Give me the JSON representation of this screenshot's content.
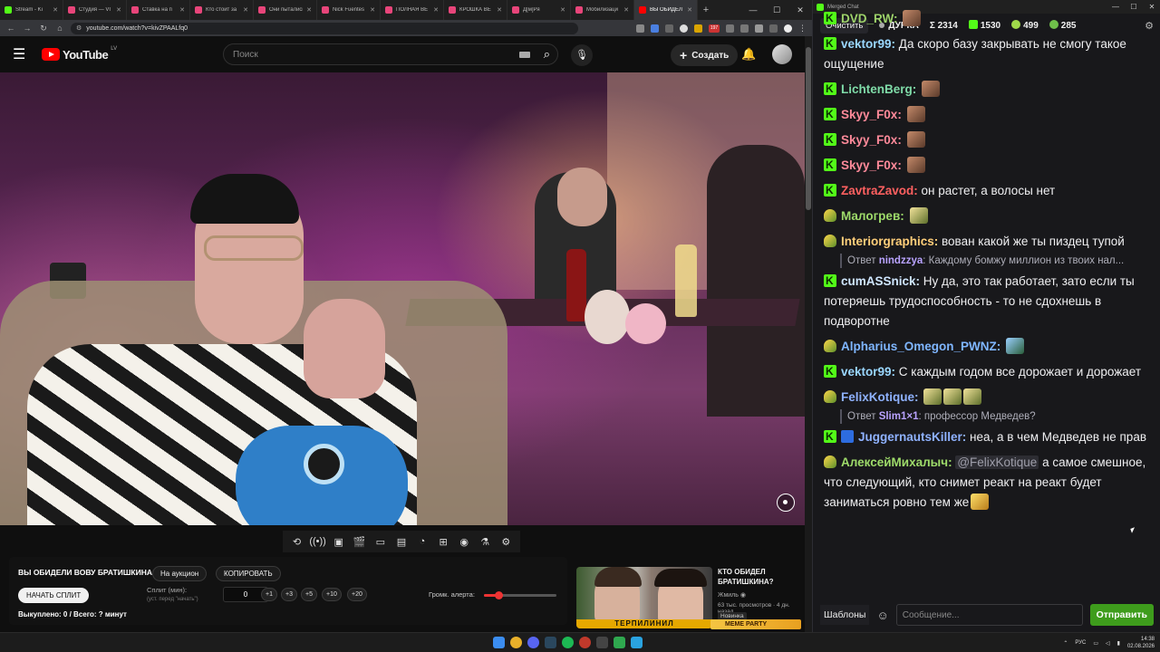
{
  "browser": {
    "tabs": [
      {
        "title": "Stream - Ki",
        "color": "#53fc18"
      },
      {
        "title": "Студия — VI",
        "color": "#e8457a"
      },
      {
        "title": "Ставка на п",
        "color": "#e8457a"
      },
      {
        "title": "Кто стоит за",
        "color": "#e8457a"
      },
      {
        "title": "Они пытались",
        "color": "#e8457a"
      },
      {
        "title": "Nick Fuentes",
        "color": "#e8457a"
      },
      {
        "title": "ПОЛНАЯ ВЕ",
        "color": "#e8457a"
      },
      {
        "title": "КРОШКА ВЕ",
        "color": "#e8457a"
      },
      {
        "title": "Д[м]Ря",
        "color": "#e8457a"
      },
      {
        "title": "Мобилизаци",
        "color": "#e8457a"
      },
      {
        "title": "ВЫ ОБИДЕЛ",
        "color": "#ff0000",
        "active": true
      }
    ],
    "url": "youtube.com/watch?v=kivZPAALfq0",
    "ext_badge": "197"
  },
  "youtube": {
    "logo": "YouTube",
    "country": "LV",
    "search_placeholder": "Поиск",
    "create_label": "Создать",
    "icons": [
      "menu-icon",
      "search-icon",
      "mic-icon",
      "bell-icon",
      "settings-icon"
    ]
  },
  "auction": {
    "title": "ВЫ ОБИДЕЛИ ВОВУ БРАТИШКИНА",
    "to_auction": "На аукцион",
    "copy": "КОПИРОВАТЬ",
    "start_split": "НАЧАТЬ СПЛИТ",
    "split_label": "Сплит (мин):",
    "split_hint": "(уст. перед \"начать\")",
    "split_value": "0",
    "steps": [
      "+1",
      "+3",
      "+5",
      "+10",
      "+20"
    ],
    "volume_label": "Громк. алерта:",
    "volume_level": 0.2,
    "status": "Выкуплено: 0 / Всего: ? минут"
  },
  "recommendation": {
    "title": "КТО ОБИДЕЛ БРАТИШКИНА?",
    "channel": "Жмиль",
    "meta": "63 тыс. просмотров · 4 дн. назад",
    "badge": "Новинка",
    "thumb_text": "ТЕРПИЛИНИЛ",
    "brand": "MEME PARTY"
  },
  "chat": {
    "window_title": "Merged Chat",
    "clear": "Очистить",
    "channel": "ДУРКА",
    "total": "Σ 2314",
    "kick_count": "1530",
    "other_count": "499",
    "third_count": "285",
    "messages": [
      {
        "badge": "k",
        "user": "DVD_RW",
        "color": "#9ed36a",
        "text": "",
        "emotes": [
          "e"
        ]
      },
      {
        "badge": "k",
        "user": "vektor99",
        "color": "#9ad7ff",
        "text": "Да скоро базу закрывать не смогу такое ощущение"
      },
      {
        "badge": "k",
        "user": "LichtenBerg",
        "color": "#7fdba8",
        "text": "",
        "emotes": [
          "e"
        ]
      },
      {
        "badge": "k",
        "user": "Skyy_F0x",
        "color": "#ff8a9a",
        "text": "",
        "emotes": [
          "e"
        ]
      },
      {
        "badge": "k",
        "user": "Skyy_F0x",
        "color": "#ff8a9a",
        "text": "",
        "emotes": [
          "e"
        ]
      },
      {
        "badge": "k",
        "user": "Skyy_F0x",
        "color": "#ff8a9a",
        "text": "",
        "emotes": [
          "e"
        ]
      },
      {
        "badge": "k",
        "user": "ZavtraZavod",
        "color": "#ff6060",
        "text": "он растет, а волосы нет"
      },
      {
        "badge": "g",
        "user": "Малогрев",
        "color": "#9edb6a",
        "text": "",
        "emotes": [
          "t"
        ]
      },
      {
        "badge": "g",
        "user": "Interiorgraphics",
        "color": "#ffcf7a",
        "text": "вован какой же ты пиздец тупой",
        "reply": {
          "label": "Ответ",
          "user": "nindzzya",
          "text": "Каждому бомжу миллион из твоих нал..."
        }
      },
      {
        "badge": "k",
        "user": "cumASSnick",
        "color": "#cfe6ff",
        "text": "Ну да, это так работает, зато если ты потеряешь трудоспособность - то не сдохнешь в подворотне"
      },
      {
        "badge": "g",
        "user": "Alpharius_Omegon_PWNZ",
        "color": "#7fb6ff",
        "text": "",
        "emotes": [
          "b"
        ]
      },
      {
        "badge": "k",
        "user": "vektor99",
        "color": "#9ad7ff",
        "text": "С каждым годом все дорожает и дорожает"
      },
      {
        "badge": "g",
        "user": "FelixKotique",
        "color": "#8fb2ff",
        "text": "",
        "emotes": [
          "t",
          "t",
          "t"
        ],
        "reply": {
          "label": "Ответ",
          "user": "Slim1×1",
          "text": "профессор Медведев?"
        }
      },
      {
        "badge": "kv",
        "user": "JuggernautsKiller",
        "color": "#8fb2ff",
        "text": "неа, а в чем Медведев не прав"
      },
      {
        "badge": "g",
        "user": "АлексейМихалыч",
        "color": "#9edb6a",
        "mention": "@FelixKotique",
        "text": "а самое смешное, что следующий, кто снимет реакт на реакт будет заниматься ровно тем же",
        "emotes_after": [
          "y"
        ]
      }
    ],
    "templates": "Шаблоны",
    "input_placeholder": "Сообщение...",
    "send": "Отправить"
  },
  "taskbar": {
    "lang": "РУС",
    "time": "14:38",
    "date": "02.08.2026"
  }
}
